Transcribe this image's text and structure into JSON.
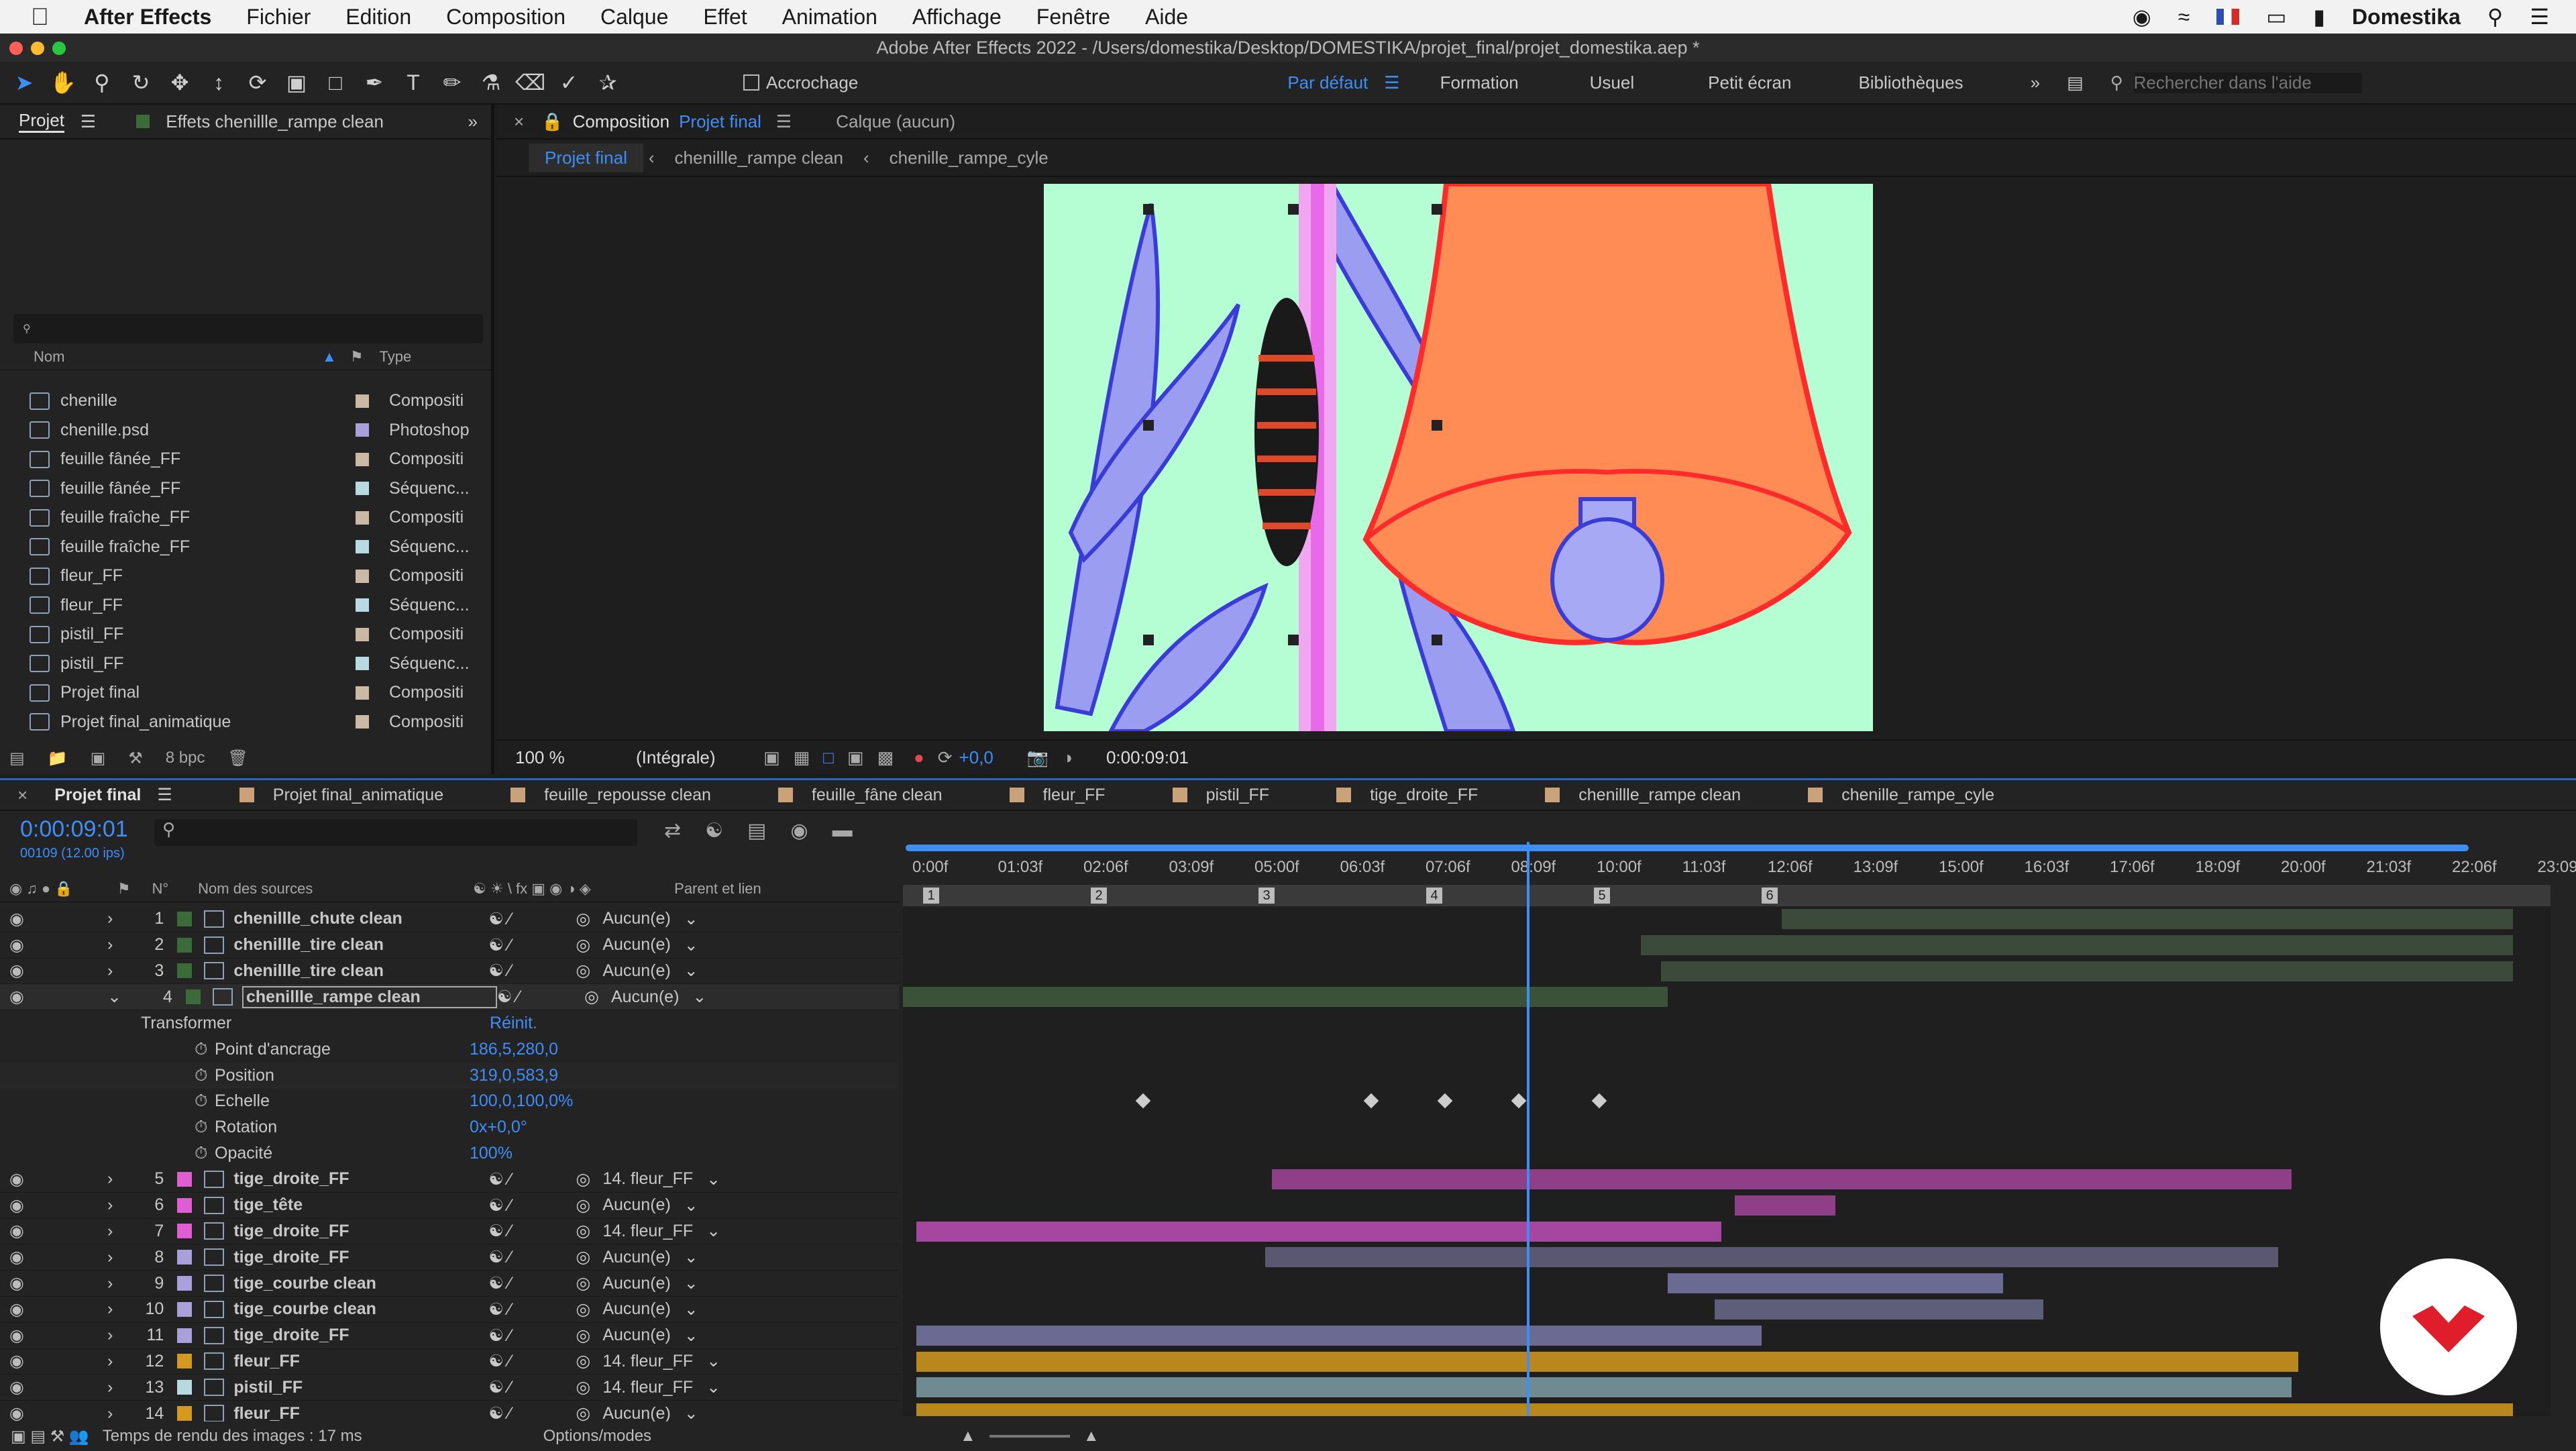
{
  "menubar": {
    "app_name": "After Effects",
    "items": [
      "Fichier",
      "Edition",
      "Composition",
      "Calque",
      "Effet",
      "Animation",
      "Affichage",
      "Fenêtre",
      "Aide"
    ],
    "user": "Domestika"
  },
  "titlebar": {
    "title": "Adobe After Effects 2022 - /Users/domestika/Desktop/DOMESTIKA/projet_final/projet_domestika.aep *"
  },
  "toolbar": {
    "snap_label": "Accrochage",
    "workspaces": [
      "Par défaut",
      "Formation",
      "Usuel",
      "Petit écran",
      "Bibliothèques"
    ],
    "search_placeholder": "Rechercher dans l'aide"
  },
  "project_panel": {
    "tab_project": "Projet",
    "tab_effects": "Effets chenillle_rampe clean",
    "col_name": "Nom",
    "col_type": "Type",
    "bpc": "8 bpc",
    "items": [
      {
        "name": "chenille",
        "type": "Compositi",
        "color": "#c9b9a5"
      },
      {
        "name": "chenille.psd",
        "type": "Photoshop",
        "color": "#a9a0d9"
      },
      {
        "name": "feuille fânée_FF",
        "type": "Compositi",
        "color": "#c9b9a5"
      },
      {
        "name": "feuille fânée_FF",
        "type": "Séquenc...",
        "color": "#b7d9e0"
      },
      {
        "name": "feuille fraîche_FF",
        "type": "Compositi",
        "color": "#c9b9a5"
      },
      {
        "name": "feuille fraîche_FF",
        "type": "Séquenc...",
        "color": "#b7d9e0"
      },
      {
        "name": "fleur_FF",
        "type": "Compositi",
        "color": "#c9b9a5"
      },
      {
        "name": "fleur_FF",
        "type": "Séquenc...",
        "color": "#b7d9e0"
      },
      {
        "name": "pistil_FF",
        "type": "Compositi",
        "color": "#c9b9a5"
      },
      {
        "name": "pistil_FF",
        "type": "Séquenc...",
        "color": "#b7d9e0"
      },
      {
        "name": "Projet final",
        "type": "Compositi",
        "color": "#c9b9a5"
      },
      {
        "name": "Projet final_animatique",
        "type": "Compositi",
        "color": "#c9b9a5"
      }
    ]
  },
  "composition_panel": {
    "tab_label": "Composition",
    "tab_comp": "Projet final",
    "layer_tab": "Calque (aucun)",
    "breadcrumbs": [
      "Projet final",
      "chenillle_rampe clean",
      "chenille_rampe_cyle"
    ],
    "zoom": "100 %",
    "resolution": "(Intégrale)",
    "exposure": "+0,0",
    "timecode": "0:00:09:01"
  },
  "timeline": {
    "tabs": [
      {
        "label": "Projet final",
        "color": "#caa27a"
      },
      {
        "label": "Projet final_animatique",
        "color": "#caa27a"
      },
      {
        "label": "feuille_repousse clean",
        "color": "#caa27a"
      },
      {
        "label": "feuille_fâne clean",
        "color": "#caa27a"
      },
      {
        "label": "fleur_FF",
        "color": "#caa27a"
      },
      {
        "label": "pistil_FF",
        "color": "#caa27a"
      },
      {
        "label": "tige_droite_FF",
        "color": "#caa27a"
      },
      {
        "label": "chenillle_rampe clean",
        "color": "#caa27a"
      },
      {
        "label": "chenille_rampe_cyle",
        "color": "#caa27a"
      }
    ],
    "current_time": "0:00:09:01",
    "frame_info": "00109 (12.00 ips)",
    "col_num": "N°",
    "col_source": "Nom des sources",
    "col_parent": "Parent et lien",
    "ruler": [
      "0:00f",
      "01:03f",
      "02:06f",
      "03:09f",
      "05:00f",
      "06:03f",
      "07:06f",
      "08:09f",
      "10:00f",
      "11:03f",
      "12:06f",
      "13:09f",
      "15:00f",
      "16:03f",
      "17:06f",
      "18:09f",
      "20:00f",
      "21:03f",
      "22:06f",
      "23:09"
    ],
    "markers": [
      "1",
      "2",
      "3",
      "4",
      "5",
      "6"
    ],
    "layers_top": [
      {
        "n": "1",
        "name": "chenillle_chute clean",
        "parent": "Aucun(e)",
        "color": "#3c6b3a"
      },
      {
        "n": "2",
        "name": "chenillle_tire clean",
        "parent": "Aucun(e)",
        "color": "#3c6b3a"
      },
      {
        "n": "3",
        "name": "chenillle_tire clean",
        "parent": "Aucun(e)",
        "color": "#3c6b3a"
      },
      {
        "n": "4",
        "name": "chenillle_rampe clean",
        "parent": "Aucun(e)",
        "color": "#3c6b3a"
      }
    ],
    "transform": {
      "group": "Transformer",
      "reset": "Réinit.",
      "props": [
        {
          "name": "Point d'ancrage",
          "value": "186,5,280,0"
        },
        {
          "name": "Position",
          "value": "319,0,583,9"
        },
        {
          "name": "Echelle",
          "value": "100,0,100,0%"
        },
        {
          "name": "Rotation",
          "value": "0x+0,0°"
        },
        {
          "name": "Opacité",
          "value": "100%"
        }
      ]
    },
    "layers_bottom": [
      {
        "n": "5",
        "name": "tige_droite_FF",
        "parent": "14. fleur_FF",
        "color": "#e05fd0"
      },
      {
        "n": "6",
        "name": "tige_tête",
        "parent": "Aucun(e)",
        "color": "#e05fd0"
      },
      {
        "n": "7",
        "name": "tige_droite_FF",
        "parent": "14. fleur_FF",
        "color": "#e05fd0"
      },
      {
        "n": "8",
        "name": "tige_droite_FF",
        "parent": "Aucun(e)",
        "color": "#a9a0d9"
      },
      {
        "n": "9",
        "name": "tige_courbe clean",
        "parent": "Aucun(e)",
        "color": "#a9a0d9"
      },
      {
        "n": "10",
        "name": "tige_courbe clean",
        "parent": "Aucun(e)",
        "color": "#a9a0d9"
      },
      {
        "n": "11",
        "name": "tige_droite_FF",
        "parent": "Aucun(e)",
        "color": "#a9a0d9"
      },
      {
        "n": "12",
        "name": "fleur_FF",
        "parent": "14. fleur_FF",
        "color": "#d39a1f"
      },
      {
        "n": "13",
        "name": "pistil_FF",
        "parent": "14. fleur_FF",
        "color": "#b7d9e0"
      },
      {
        "n": "14",
        "name": "fleur_FF",
        "parent": "Aucun(e)",
        "color": "#d39a1f"
      }
    ],
    "render_time": "Temps de rendu des images : 17 ms",
    "options": "Options/modes"
  }
}
